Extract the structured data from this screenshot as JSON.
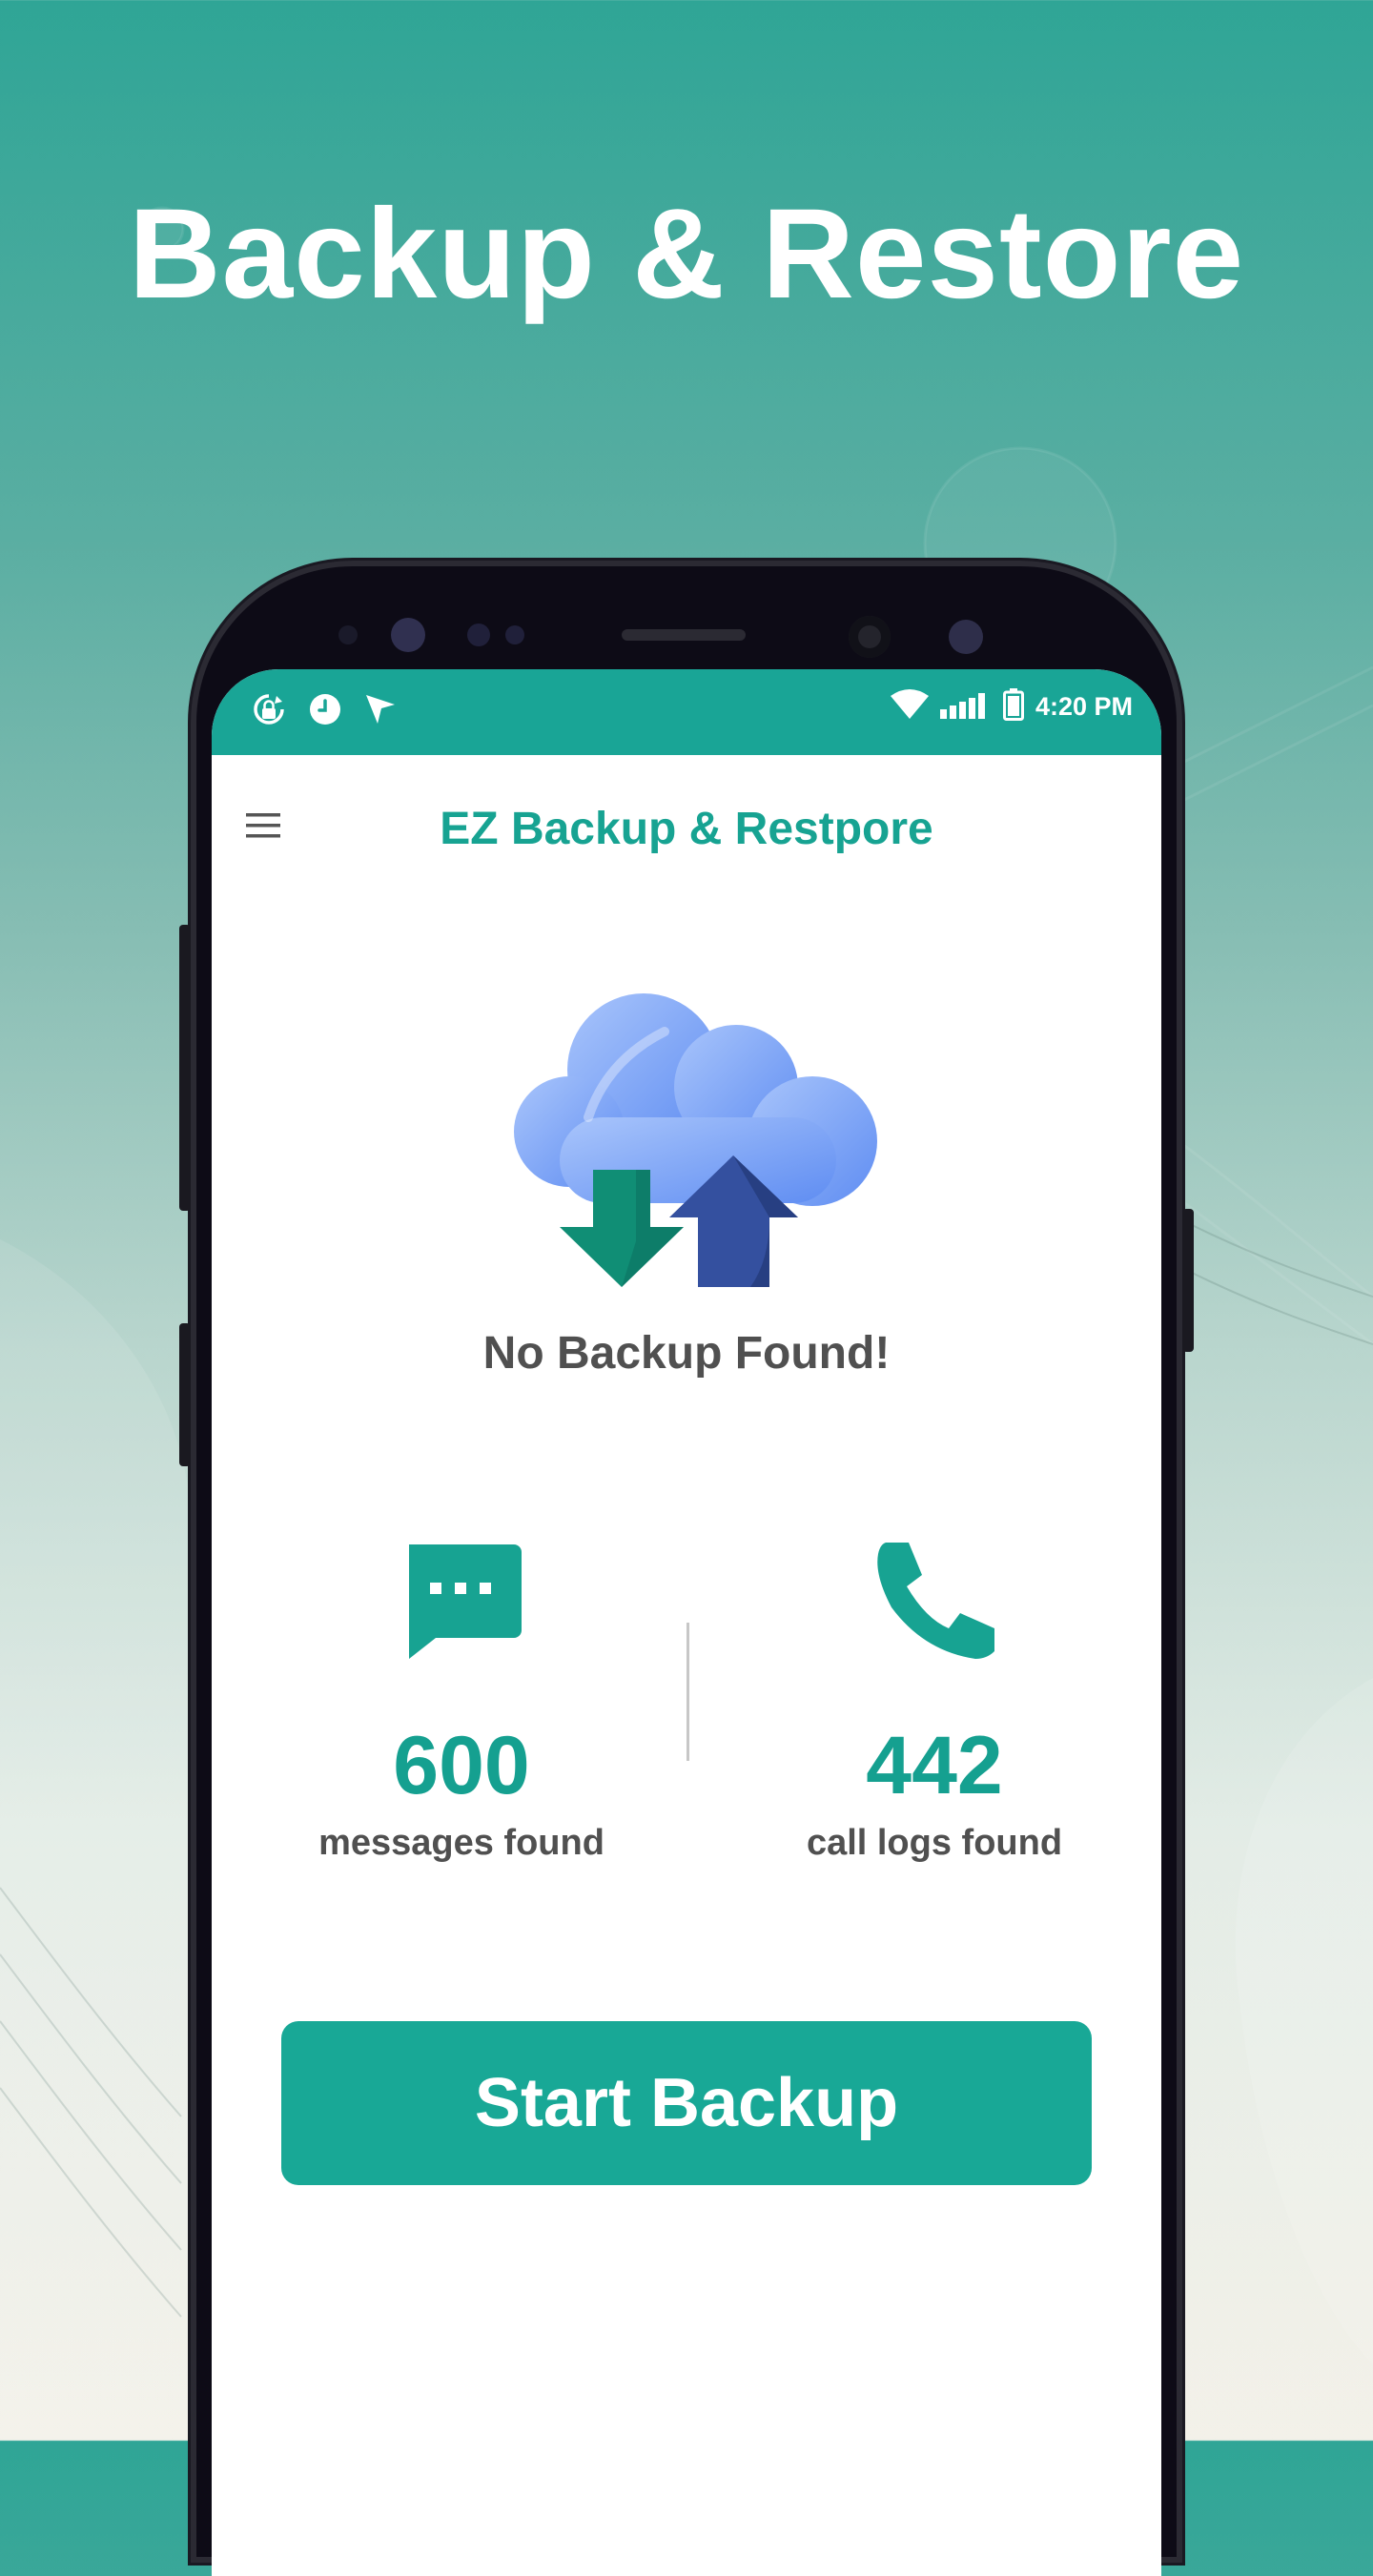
{
  "headline": "Backup & Restore",
  "colors": {
    "accent": "#18a896",
    "status_bar": "#19a596",
    "text_dark": "#505050",
    "cloud": "#7fa7f6",
    "arrow_down": "#0f8a73",
    "arrow_up": "#2f4a98"
  },
  "status_bar": {
    "left_icons": [
      "sync-lock-icon",
      "clock-icon",
      "location-arrow-icon"
    ],
    "right_icons": [
      "wifi-icon",
      "signal-icon",
      "battery-icon"
    ],
    "time": "4:20 PM"
  },
  "app_bar": {
    "menu_icon": "hamburger-menu-icon",
    "title": "EZ Backup & Restpore"
  },
  "main": {
    "illustration": "cloud-upload-download-icon",
    "status_message": "No Backup Found!",
    "stats": [
      {
        "icon": "message-icon",
        "count": "600",
        "label": "messages found"
      },
      {
        "icon": "phone-icon",
        "count": "442",
        "label": "call logs found"
      }
    ],
    "primary_button": "Start Backup"
  }
}
